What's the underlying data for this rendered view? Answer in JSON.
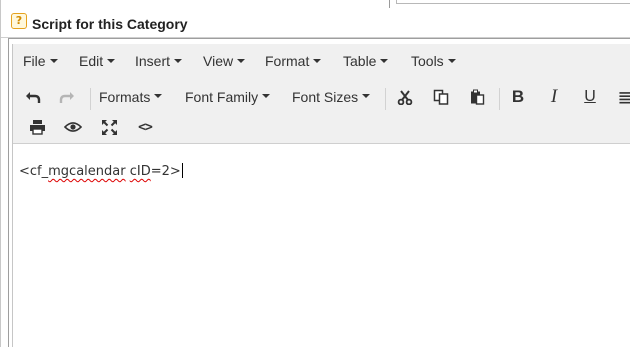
{
  "category_header": {
    "help_icon": "help-icon",
    "help_glyph": "?",
    "title": "Script for this Category"
  },
  "menubar": {
    "items": [
      "File",
      "Edit",
      "Insert",
      "View",
      "Format",
      "Table",
      "Tools"
    ]
  },
  "toolbar": {
    "row1": {
      "undo": "undo-icon",
      "redo": "redo-icon",
      "formats": "Formats",
      "font_family": "Font Family",
      "font_sizes": "Font Sizes",
      "cut": "cut-icon",
      "copy": "copy-icon",
      "paste": "paste-icon",
      "bold": "B",
      "italic": "I",
      "underline": "U",
      "align": "align-icon"
    },
    "row2": {
      "print": "print-icon",
      "preview": "eye-icon",
      "fullscreen": "fullscreen-icon",
      "source_code": "<>"
    }
  },
  "editor": {
    "content_prefix": "<cf_",
    "content_misspelled": "mgcalendar",
    "content_space": " ",
    "content_attr": "cID",
    "content_suffix": "=2>"
  },
  "colors": {
    "toolbar_bg": "#f0f0f0",
    "help_icon_border": "#e6a21d",
    "spellcheck": "#dd0000"
  }
}
